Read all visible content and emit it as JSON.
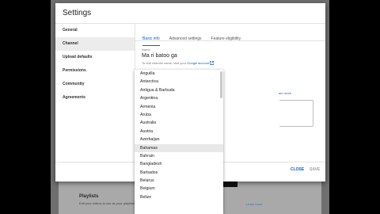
{
  "background": {
    "playlists_heading": "Playlists",
    "playlists_desc": "Edit your videos to use as your playlists",
    "learn_more": "Learn more"
  },
  "dialog": {
    "title": "Settings",
    "sidebar": [
      {
        "label": "General",
        "active": false
      },
      {
        "label": "Channel",
        "active": true
      },
      {
        "label": "Upload defaults",
        "active": false
      },
      {
        "label": "Permissions",
        "active": false
      },
      {
        "label": "Community",
        "active": false
      },
      {
        "label": "Agreements",
        "active": false
      }
    ],
    "tabs": [
      {
        "label": "Basic info",
        "active": true
      },
      {
        "label": "Advanced settings",
        "active": false
      },
      {
        "label": "Feature eligibility",
        "active": false
      }
    ],
    "name_label": "Name",
    "name_value": "Ma ri batoo ga",
    "name_hint_prefix": "To edit channel name, visit your ",
    "name_hint_link": "Google account",
    "learn_more": "arn more",
    "close_label": "CLOSE",
    "save_label": "SAVE"
  },
  "country_dropdown": {
    "options": [
      "Anguilla",
      "Antarctica",
      "Antigua & Barbuda",
      "Argentina",
      "Armenia",
      "Aruba",
      "Australia",
      "Austria",
      "Azerbaijan",
      "Bahamas",
      "Bahrain",
      "Bangladesh",
      "Barbados",
      "Belarus",
      "Belgium",
      "Belize"
    ],
    "hovered": "Bahamas"
  }
}
